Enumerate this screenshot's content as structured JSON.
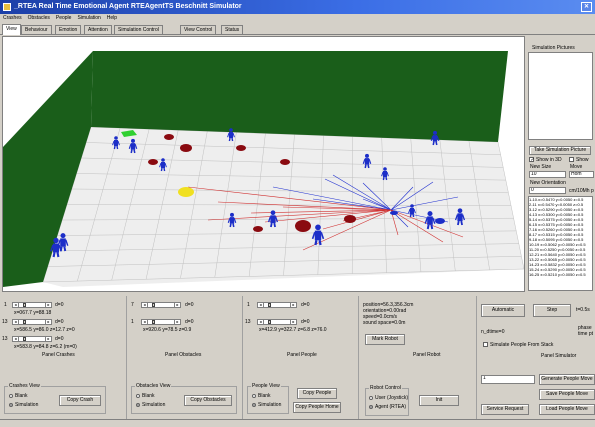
{
  "titlebar": {
    "title": "_RTEA  Real Time Emotional Agent   RTEAgentTS Beschnitt   Simulator",
    "close_glyph": "✕"
  },
  "menu": [
    "Crashes",
    "Obstacles",
    "People",
    "Simulation",
    "Help"
  ],
  "tabs": [
    "View",
    "Behaviour",
    "Emotion",
    "Attention",
    "Simulation Control",
    "View Control",
    "Status"
  ],
  "active_tab": 0,
  "colors": {
    "floor": "#eeeeee",
    "wall": "#1a5e1a",
    "grid": "#c0c0c0",
    "agent": "#1c2ec8",
    "obstacle": "#8a0a10",
    "ray_red": "#d03030",
    "ray_blue": "#2030d0",
    "green_tile": "#30d030",
    "yellow_disc": "#f0e020"
  },
  "right_panel": {
    "pictures_label": "Simulation Pictures",
    "take_button": "Take Simulation Picture",
    "check_3d": "Show in 3D",
    "check_show": "Show",
    "new_size_label": "New Size",
    "new_size_value": "10",
    "move_label": "Move",
    "move_value": "Hom",
    "new_orientation_label": "New Orientation",
    "new_orientation_value": "0",
    "unit_text": "cm/10Mh p",
    "list_lines": [
      "1-10.x=0.5470 y=0.0050 z=0.5",
      "2-11 x=0.5470 y=0.0050 z=0.5",
      "3-12 x=0.5290 y=0.0050 z=0.5",
      "4-13 x=0.5300 y=0.0050 z=0.5",
      "5-14 x=0.5375 y=0.0050 z=0.5",
      "6-15 x=0.5375 y=0.0050 z=0.5",
      "7-16 x=0.5260 y=0.0050 z=0.5",
      "8-17 x=0.5315 y=0.0050 z=0.5",
      "9-18 x=0.5095 y=0.0050 z=0.5",
      "10-19 x=0.5062 y=0.0050 z=0.5",
      "11-20 x=0.5250 y=0.0050 z=0.5",
      "12-21 x=0.5640 y=0.0050 z=0.5",
      "13-22 x=0.5065 y=0.0050 z=0.5",
      "14-23 x=0.5832 y=0.0050 z=0.5",
      "15-24 x=0.5290 y=0.0050 z=0.5",
      "16-25 x=0.5210 y=0.0050 z=0.5"
    ]
  },
  "crashes": {
    "rows": [
      {
        "num": "1",
        "val": "d=0"
      },
      {
        "num": "13",
        "val": "d=0"
      },
      {
        "num": "13",
        "val": "d=0"
      }
    ],
    "info": [
      "x=067.7 y=88.18",
      "x=586.5 y=86.0 z=12.7 z=0",
      "x=583.8 y=84.8 z=6.2 (m=0)"
    ],
    "panel_title": "Panel Crashes",
    "group_title": "Crashes View",
    "radio_blank": "Blank",
    "radio_sim": "Simulation",
    "copy_button": "Copy Crash"
  },
  "obstacles": {
    "rows": [
      {
        "num": "7",
        "val": "d=0"
      },
      {
        "num": "1",
        "val": "d=0"
      }
    ],
    "info": [
      "x=920.6 y=78.5 z=0.9"
    ],
    "panel_title": "Panel Obstacles",
    "group_title": "Obstacles View",
    "radio_blank": "Blank",
    "radio_sim": "Simulation",
    "copy_button": "Copy Obstacles"
  },
  "people": {
    "rows": [
      {
        "num": "1",
        "val": "d=0"
      },
      {
        "num": "13",
        "val": "d=0"
      }
    ],
    "info": [
      "x=412.9 y=322.7 z=6.8 z=76.0"
    ],
    "panel_title": "Panel People",
    "group_title": "People View",
    "radio_blank": "Blank",
    "radio_sim": "Simulation",
    "copy_button": "Copy People",
    "copy_home_button": "Copy People Home"
  },
  "robot": {
    "info": [
      "position=56.3,356.3cm",
      "orientation=0.00rad",
      "speed=0.0cm/s",
      "sound space=0.0m"
    ],
    "mark_button": "Mark Robot",
    "panel_title": "Panel Robot",
    "group_title": "Robot Control",
    "radio_user": "User (Joystick)",
    "radio_agent": "Agent (RTEA)",
    "init_button": "Init"
  },
  "simulation": {
    "automatic_button": "Automatic",
    "step_button": "Step",
    "t_text": "t=0.5s",
    "n_text": "n_dtime=0",
    "phase_text": "phase",
    "time_text": "time pt",
    "check_simulate": "Simulate People From Stack",
    "panel_title": "Panel Simulator",
    "input_value": "1",
    "gen_button": "Generate People Move",
    "save_button": "Save People Move",
    "load_button": "Load People Move",
    "request_button": "Service Request"
  }
}
